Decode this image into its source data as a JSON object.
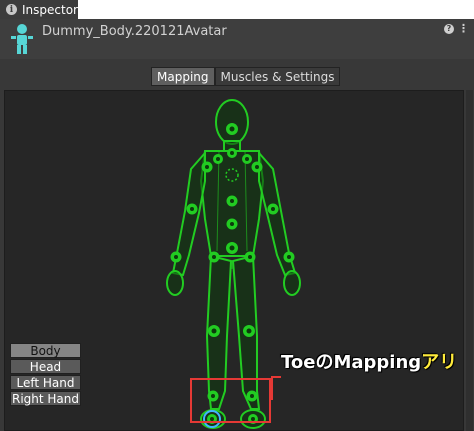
{
  "window": {
    "tab_label": "Inspector"
  },
  "header": {
    "title": "Dummy_Body.220121Avatar",
    "help_icon": "question-icon",
    "menu_icon": "kebab-menu-icon"
  },
  "mode_tabs": [
    {
      "label": "Mapping",
      "active": true
    },
    {
      "label": "Muscles & Settings",
      "active": false
    }
  ],
  "body_part_buttons": [
    {
      "label": "Body",
      "active": true
    },
    {
      "label": "Head",
      "active": false
    },
    {
      "label": "Left Hand",
      "active": false
    },
    {
      "label": "Right Hand",
      "active": false
    }
  ],
  "annotation": {
    "text_main": "ToeのMapping",
    "text_highlight": "アリ"
  },
  "colors": {
    "bone_green": "#1fbf1f",
    "selected_blue": "#3fb5ff",
    "callout_red": "#e53935",
    "highlight_yellow": "#ffeb3b"
  }
}
